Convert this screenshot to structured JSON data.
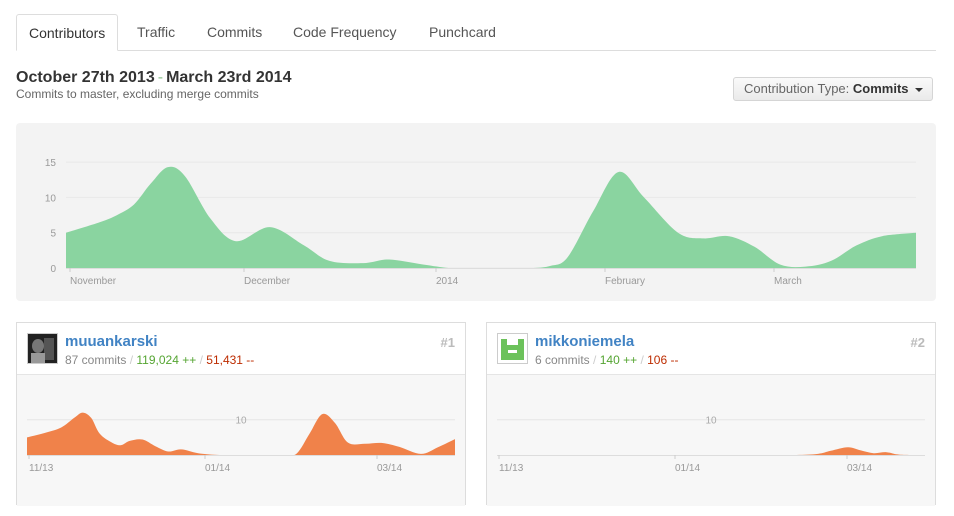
{
  "tabs": [
    {
      "label": "Contributors",
      "active": true
    },
    {
      "label": "Traffic",
      "active": false
    },
    {
      "label": "Commits",
      "active": false
    },
    {
      "label": "Code Frequency",
      "active": false
    },
    {
      "label": "Punchcard",
      "active": false
    }
  ],
  "header": {
    "date_start": "October 27th 2013",
    "date_sep": "-",
    "date_end": "March 23rd 2014",
    "subtitle": "Commits to master, excluding merge commits"
  },
  "contribution_type": {
    "prefix": "Contribution Type:",
    "value": "Commits"
  },
  "colors": {
    "main_area": "#8ad4a0",
    "contrib_area": "#f0824a",
    "link": "#4183c4",
    "add": "#55a532",
    "del": "#bd2c00"
  },
  "chart_data": [
    {
      "type": "area",
      "yticks": [
        "15",
        "10",
        "5",
        "0"
      ],
      "ylim": [
        0,
        17
      ],
      "xticks": [
        "November",
        "December",
        "2014",
        "February",
        "March"
      ],
      "x": [
        0,
        4,
        6,
        8,
        10,
        12,
        14,
        17,
        20,
        24,
        28,
        31,
        35,
        38,
        42,
        45,
        47,
        49,
        52,
        55,
        57,
        59,
        62,
        65,
        68,
        72,
        75,
        78,
        81,
        84,
        87,
        90,
        93,
        96,
        100
      ],
      "values": [
        5,
        6.5,
        7.5,
        9,
        12,
        14.3,
        13,
        7,
        3.8,
        5.8,
        3.2,
        1,
        0.7,
        1.2,
        0.5,
        0,
        0,
        0,
        0,
        0,
        0.3,
        1.5,
        8,
        13.6,
        10,
        5,
        4.2,
        4.5,
        3,
        0.5,
        0.2,
        1,
        3.2,
        4.5,
        5
      ]
    }
  ],
  "contributors": [
    {
      "name": "muuankarski",
      "rank": "#1",
      "commits": "87 commits",
      "additions": "119,024 ++",
      "deletions": "51,431 --",
      "chart_data": {
        "type": "area",
        "ymark": "10",
        "ylim": [
          0,
          17
        ],
        "xticks": [
          "11/13",
          "01/14",
          "03/14"
        ],
        "x": [
          0,
          4,
          8,
          11,
          13,
          15,
          17,
          20,
          22,
          24,
          27,
          30,
          33,
          36,
          40,
          45,
          50,
          55,
          60,
          63,
          66,
          69,
          72,
          75,
          79,
          83,
          87,
          92,
          96,
          100
        ],
        "values": [
          5,
          6.2,
          7.8,
          10.5,
          12,
          10.5,
          6,
          3.4,
          2.8,
          4,
          4.4,
          2.5,
          1,
          1.6,
          0.5,
          0,
          0,
          0,
          0,
          0.4,
          6,
          11.6,
          9,
          3.5,
          3.2,
          3.4,
          2.3,
          0.3,
          2.2,
          4.5
        ]
      }
    },
    {
      "name": "mikkoniemela",
      "rank": "#2",
      "commits": "6 commits",
      "additions": "140 ++",
      "deletions": "106 --",
      "chart_data": {
        "type": "area",
        "ymark": "10",
        "ylim": [
          0,
          17
        ],
        "xticks": [
          "11/13",
          "01/14",
          "03/14"
        ],
        "x": [
          0,
          40,
          60,
          65,
          70,
          75,
          78,
          82,
          85,
          88,
          91,
          94,
          100
        ],
        "values": [
          0,
          0,
          0,
          0,
          0,
          0.3,
          1.2,
          2.2,
          1.3,
          0.5,
          0.8,
          0.1,
          0
        ]
      }
    }
  ]
}
